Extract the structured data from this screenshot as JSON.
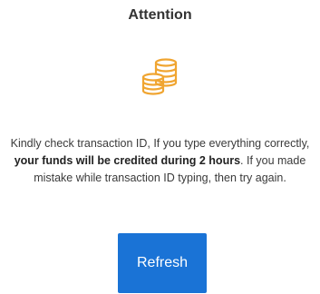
{
  "dialog": {
    "title": "Attention",
    "icon": "coins-stack-icon",
    "message": {
      "part1": "Kindly check transaction ID, If you type everything correctly, ",
      "bold": "your funds will be credited during 2 hours",
      "part2": ". If you made mistake while transaction ID typing, then try again."
    },
    "refresh_label": "Refresh"
  },
  "colors": {
    "accent": "#1a73d6",
    "icon": "#f0a531",
    "text": "#3a3a3a"
  }
}
